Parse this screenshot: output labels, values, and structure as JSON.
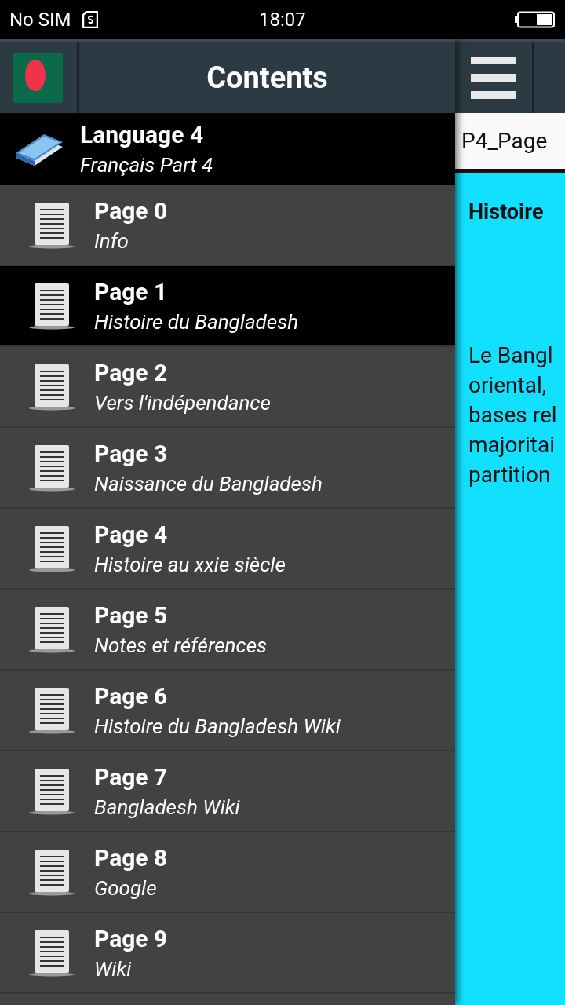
{
  "status_bar": {
    "carrier": "No SIM",
    "time": "18:07"
  },
  "drawer": {
    "title": "Contents",
    "header_item": {
      "title": "Language 4",
      "subtitle": "Français Part 4"
    },
    "items": [
      {
        "title": "Page 0",
        "subtitle": "Info",
        "selected": false
      },
      {
        "title": "Page 1",
        "subtitle": "Histoire du Bangladesh",
        "selected": true
      },
      {
        "title": "Page 2",
        "subtitle": "Vers l'indépendance",
        "selected": false
      },
      {
        "title": "Page 3",
        "subtitle": "Naissance du Bangladesh",
        "selected": false
      },
      {
        "title": "Page 4",
        "subtitle": "Histoire au xxie siècle",
        "selected": false
      },
      {
        "title": "Page 5",
        "subtitle": "Notes et références",
        "selected": false
      },
      {
        "title": "Page 6",
        "subtitle": "Histoire du Bangladesh Wiki",
        "selected": false
      },
      {
        "title": "Page 7",
        "subtitle": "Bangladesh Wiki",
        "selected": false
      },
      {
        "title": "Page 8",
        "subtitle": "Google",
        "selected": false
      },
      {
        "title": "Page 9",
        "subtitle": "Wiki",
        "selected": false
      }
    ]
  },
  "content": {
    "page_title": "P4_Page",
    "heading": "Histoire",
    "paragraph": "Le Bangl\noriental,\nbases rel\nmajoritai\npartition"
  }
}
